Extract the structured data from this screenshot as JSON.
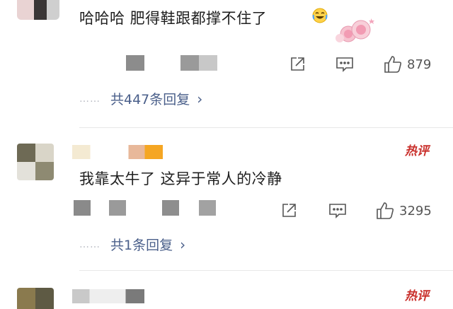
{
  "colors": {
    "link": "#4a5f8a",
    "hot": "#c9302c",
    "text": "#1f1f1f",
    "meta": "#555555"
  },
  "comments": [
    {
      "text": "哈哈哈 肥得鞋跟都撑不住了",
      "emoji_icon": "laughing-tears-emoji-icon",
      "sticker_icon": "pink-roses-sticker-icon",
      "share_icon": "share-icon",
      "comment_icon": "comment-icon",
      "like_icon": "thumbs-up-icon",
      "like_count": "879",
      "reply_dots": "……",
      "reply_label": "共447条回复",
      "reply_chevron": "›"
    },
    {
      "hot_label": "热评",
      "text": "我靠太牛了 这异于常人的冷静",
      "share_icon": "share-icon",
      "comment_icon": "comment-icon",
      "like_icon": "thumbs-up-icon",
      "like_count": "3295",
      "reply_dots": "……",
      "reply_label": "共1条回复",
      "reply_chevron": "›"
    },
    {
      "hot_label": "热评"
    }
  ]
}
